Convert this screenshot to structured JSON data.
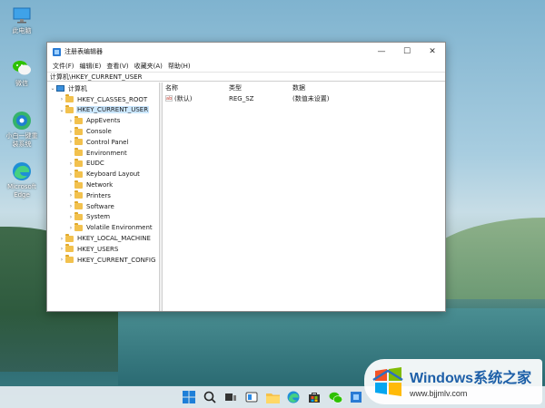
{
  "desktop": {
    "icons": [
      {
        "label": "此电脑"
      },
      {
        "label": "微信"
      },
      {
        "label": "小白一键重装系统"
      },
      {
        "label": "Microsoft Edge"
      }
    ]
  },
  "window": {
    "title": "注册表编辑器",
    "controls": {
      "minimize": "—",
      "maximize": "☐",
      "close": "✕"
    },
    "menu": [
      "文件(F)",
      "编辑(E)",
      "查看(V)",
      "收藏夹(A)",
      "帮助(H)"
    ],
    "address": "计算机\\HKEY_CURRENT_USER"
  },
  "tree": {
    "root": "计算机",
    "hives": [
      {
        "label": "HKEY_CLASSES_ROOT"
      },
      {
        "label": "HKEY_CURRENT_USER"
      },
      {
        "label": "HKEY_LOCAL_MACHINE"
      },
      {
        "label": "HKEY_USERS"
      },
      {
        "label": "HKEY_CURRENT_CONFIG"
      }
    ],
    "current_user_children": [
      "AppEvents",
      "Console",
      "Control Panel",
      "Environment",
      "EUDC",
      "Keyboard Layout",
      "Network",
      "Printers",
      "Software",
      "System",
      "Volatile Environment"
    ]
  },
  "values": {
    "columns": {
      "name": "名称",
      "type": "类型",
      "data": "数据"
    },
    "rows": [
      {
        "icon": "ab",
        "name": "(默认)",
        "type": "REG_SZ",
        "data": "(数值未设置)"
      }
    ]
  },
  "taskbar": {
    "icons": [
      "start-icon",
      "search-icon",
      "task-view-icon",
      "widgets-icon",
      "file-explorer-icon",
      "edge-icon",
      "store-icon",
      "wechat-icon",
      "regedit-icon"
    ]
  },
  "watermark": {
    "brand": "Windows",
    "brand_cn": "系统之家",
    "url": "www.bjjmlv.com"
  },
  "colors": {
    "accent": "#2a7bd4",
    "selection": "#cce8ff",
    "folder": "#f2c14e"
  }
}
